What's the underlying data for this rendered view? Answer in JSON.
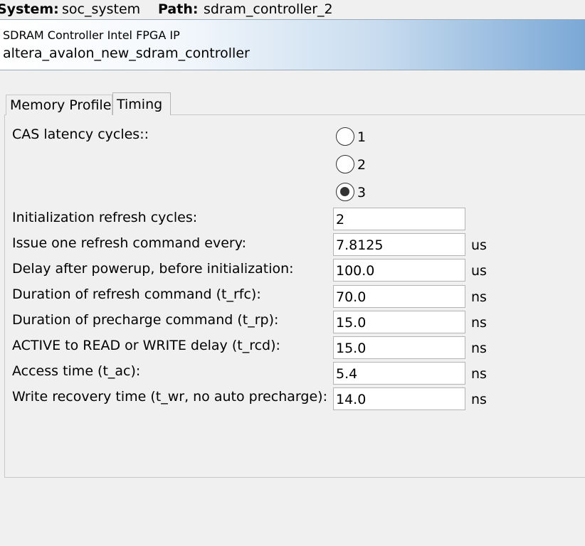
{
  "topbar": {
    "system_label": "System:",
    "system_value": "soc_system",
    "path_label": "Path:",
    "path_value": "sdram_controller_2"
  },
  "banner": {
    "ip_name": "SDRAM Controller Intel FPGA IP",
    "component": "altera_avalon_new_sdram_controller"
  },
  "tabs": [
    {
      "label": "Memory Profile",
      "active": false
    },
    {
      "label": "Timing",
      "active": true
    }
  ],
  "timing": {
    "cas_label": "CAS latency cycles::",
    "cas_options": [
      "1",
      "2",
      "3"
    ],
    "cas_selected": "3",
    "fields": [
      {
        "label": "Initialization refresh cycles:",
        "value": "2",
        "unit": ""
      },
      {
        "label": "Issue one refresh command every:",
        "value": "7.8125",
        "unit": "us"
      },
      {
        "label": "Delay after powerup, before initialization:",
        "value": "100.0",
        "unit": "us"
      },
      {
        "label": "Duration of refresh command (t_rfc):",
        "value": "70.0",
        "unit": "ns"
      },
      {
        "label": "Duration of precharge command (t_rp):",
        "value": "15.0",
        "unit": "ns"
      },
      {
        "label": "ACTIVE to READ or WRITE delay (t_rcd):",
        "value": "15.0",
        "unit": "ns"
      },
      {
        "label": "Access time (t_ac):",
        "value": "5.4",
        "unit": "ns"
      },
      {
        "label": "Write recovery time (t_wr, no auto precharge):",
        "value": "14.0",
        "unit": "ns"
      }
    ]
  }
}
